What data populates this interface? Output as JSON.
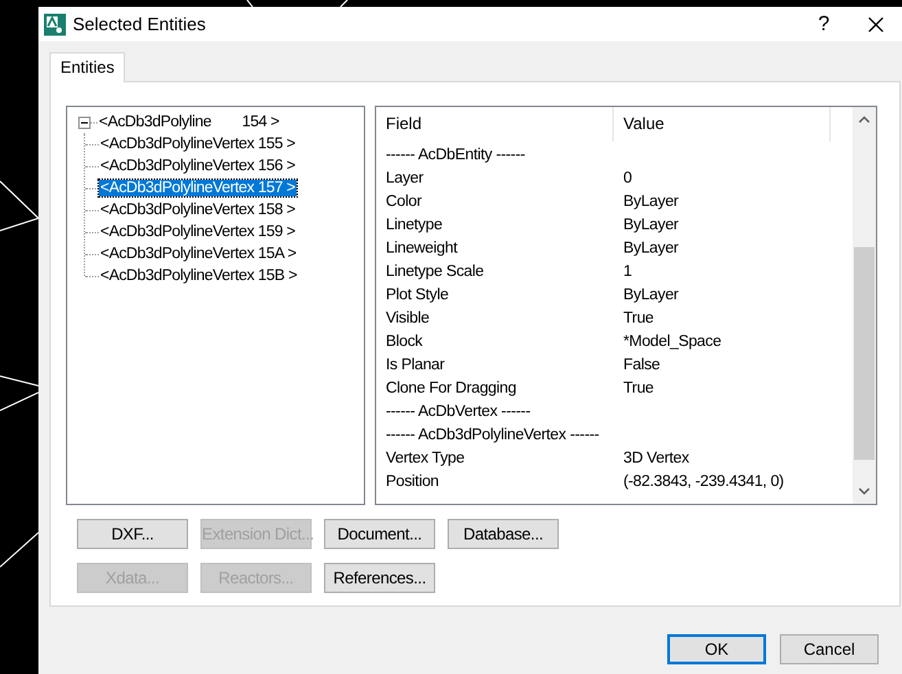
{
  "window": {
    "title": "Selected Entities",
    "help": "?"
  },
  "tabs": [
    {
      "label": "Entities",
      "selected": true
    }
  ],
  "tree": {
    "label": "<AcDb3dPolyline        154 >",
    "expanded": true,
    "children": [
      {
        "label": "<AcDb3dPolylineVertex 155 >",
        "selected": false
      },
      {
        "label": "<AcDb3dPolylineVertex 156 >",
        "selected": false
      },
      {
        "label": "<AcDb3dPolylineVertex 157 >",
        "selected": true
      },
      {
        "label": "<AcDb3dPolylineVertex 158 >",
        "selected": false
      },
      {
        "label": "<AcDb3dPolylineVertex 159 >",
        "selected": false
      },
      {
        "label": "<AcDb3dPolylineVertex 15A >",
        "selected": false
      },
      {
        "label": "<AcDb3dPolylineVertex 15B >",
        "selected": false
      }
    ]
  },
  "properties": {
    "columns": [
      "Field",
      "Value"
    ],
    "rows": [
      {
        "kind": "section",
        "field": "------ AcDbEntity ------"
      },
      {
        "kind": "value",
        "field": "Layer",
        "value": "0"
      },
      {
        "kind": "value",
        "field": "Color",
        "value": "ByLayer"
      },
      {
        "kind": "value",
        "field": "Linetype",
        "value": "ByLayer"
      },
      {
        "kind": "value",
        "field": "Lineweight",
        "value": "ByLayer"
      },
      {
        "kind": "value",
        "field": "Linetype Scale",
        "value": "1"
      },
      {
        "kind": "value",
        "field": "Plot Style",
        "value": "ByLayer"
      },
      {
        "kind": "value",
        "field": "Visible",
        "value": "True"
      },
      {
        "kind": "value",
        "field": "Block",
        "value": "*Model_Space"
      },
      {
        "kind": "value",
        "field": "Is Planar",
        "value": "False"
      },
      {
        "kind": "value",
        "field": "Clone For Dragging",
        "value": "True"
      },
      {
        "kind": "section",
        "field": "------ AcDbVertex ------"
      },
      {
        "kind": "section",
        "field": "------ AcDb3dPolylineVertex ------"
      },
      {
        "kind": "value",
        "field": "Vertex Type",
        "value": "3D Vertex"
      },
      {
        "kind": "value",
        "field": "Position",
        "value": "(-82.3843, -239.4341, 0)"
      }
    ]
  },
  "buttons": [
    [
      {
        "label": "DXF...",
        "disabled": false
      },
      {
        "label": "Extension Dict...",
        "disabled": true
      },
      {
        "label": "Document...",
        "disabled": false
      },
      {
        "label": "Database...",
        "disabled": false
      }
    ],
    [
      {
        "label": "Xdata...",
        "disabled": true
      },
      {
        "label": "Reactors...",
        "disabled": true
      },
      {
        "label": "References...",
        "disabled": false
      }
    ]
  ],
  "footer": [
    {
      "label": "OK",
      "default": true
    },
    {
      "label": "Cancel",
      "default": false
    }
  ]
}
